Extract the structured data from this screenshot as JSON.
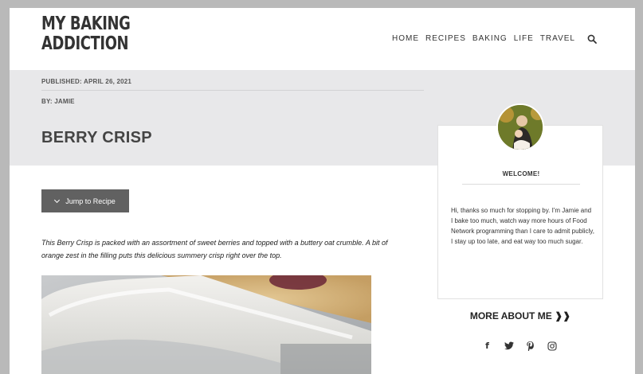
{
  "site": {
    "logo_line1": "MY BAKING",
    "logo_line2": "ADDICTION"
  },
  "nav": {
    "items": [
      "HOME",
      "RECIPES",
      "BAKING",
      "LIFE",
      "TRAVEL"
    ],
    "search_icon": "search-icon"
  },
  "post": {
    "published": "PUBLISHED: APRIL 26, 2021",
    "author": "BY: JAMIE",
    "title": "BERRY CRISP",
    "jump_label": "Jump to Recipe",
    "intro": "This Berry Crisp is packed with an assortment of sweet berries and topped with a buttery oat crumble. A bit of orange zest in the filling puts this delicious summery crisp right over the top."
  },
  "sidebar": {
    "welcome": "WELCOME!",
    "bio": "Hi, thanks so much for stopping by. I'm Jamie and I bake too much, watch way more hours of Food Network programming than I care to admit publicly, I stay up too late, and eat way too much sugar.",
    "more_about": "MORE ABOUT ME",
    "more_about_suffix": "❱❱",
    "social": [
      {
        "icon": "facebook-icon",
        "glyph": "f"
      },
      {
        "icon": "twitter-icon",
        "glyph": "𝕥"
      },
      {
        "icon": "pinterest-icon",
        "glyph": "P"
      },
      {
        "icon": "instagram-icon",
        "glyph": "◎"
      }
    ]
  },
  "colors": {
    "hero_bg": "#e8e8ea",
    "button_bg": "#616161",
    "frame": "#b9b9b9"
  }
}
